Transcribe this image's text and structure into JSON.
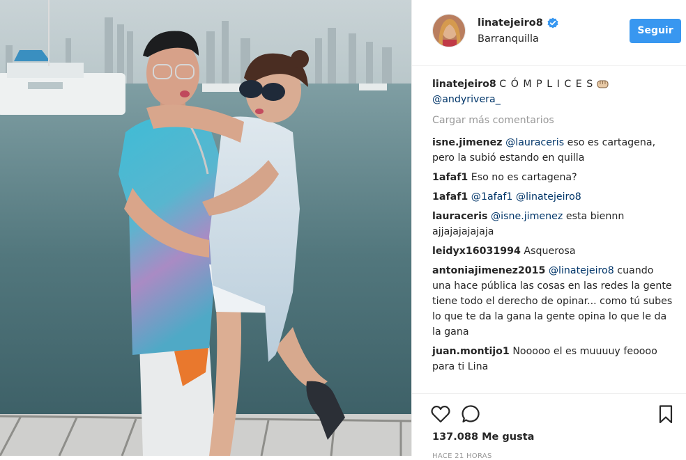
{
  "post": {
    "author": {
      "username": "linatejeiro8",
      "location": "Barranquilla",
      "verified": true
    },
    "follow_label": "Seguir",
    "caption": {
      "username": "linatejeiro8",
      "text": "C Ó M P L I C E S",
      "mention": "@andyrivera_"
    },
    "load_more": "Cargar más comentarios",
    "comments": [
      {
        "username": "isne.jimenez",
        "mention": "@lauraceris",
        "text": "eso es cartagena, pero la subió estando en quilla"
      },
      {
        "username": "1afaf1",
        "mention": "",
        "text": "Eso no es cartagena?"
      },
      {
        "username": "1afaf1",
        "mention": "@1afaf1 @linatejeiro8",
        "text": ""
      },
      {
        "username": "lauraceris",
        "mention": "@isne.jimenez",
        "text": "esta biennn ajjajajajajaja"
      },
      {
        "username": "leidyx16031994",
        "mention": "",
        "text": "Asquerosa"
      },
      {
        "username": "antoniajimenez2015",
        "mention": "@linatejeiro8",
        "text": "cuando una hace pública las cosas en las redes la gente tiene todo el derecho de opinar... como tú subes lo que te da la gana la gente opina lo que le da la gana"
      },
      {
        "username": "juan.montijo1",
        "mention": "",
        "text": "Nooooo el es muuuuy feoooo para ti Lina"
      }
    ],
    "likes": "137.088 Me gusta",
    "timestamp": "HACE 21 HORAS"
  },
  "icons": {
    "like": "heart-outline-icon",
    "comment": "comment-bubble-icon",
    "save": "bookmark-icon",
    "verified": "verified-badge-icon",
    "caption_emoji": "fist-emoji-icon"
  },
  "colors": {
    "accent": "#3897f0",
    "mention": "#003569",
    "muted": "#999999",
    "text": "#262626"
  }
}
